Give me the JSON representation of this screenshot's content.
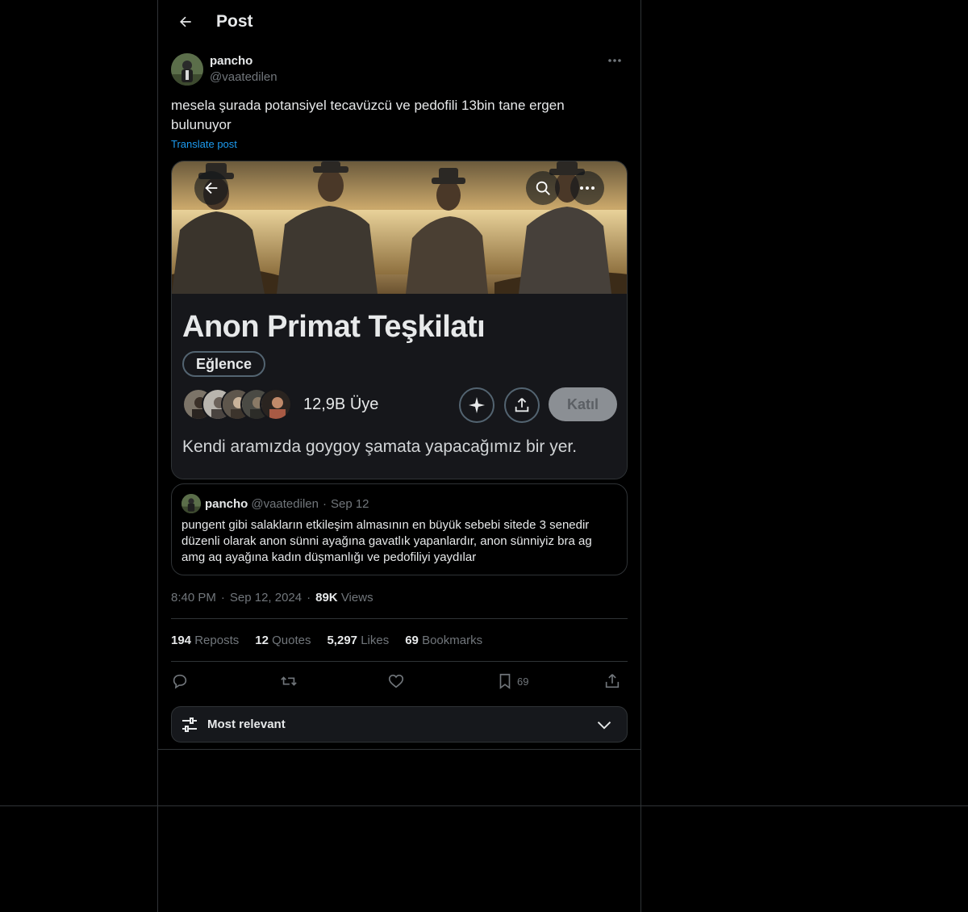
{
  "header": {
    "title": "Post"
  },
  "post": {
    "display_name": "pancho",
    "handle": "@vaatedilen",
    "text": "mesela şurada potansiyel tecavüzcü ve pedofili 13bin tane ergen bulunuyor",
    "translate_label": "Translate post",
    "time": "8:40 PM",
    "date": "Sep 12, 2024",
    "views_count": "89K",
    "views_label": "Views"
  },
  "media": {
    "community_name": "Anon Primat Teşkilatı",
    "category": "Eğlence",
    "member_count": "12,9B Üye",
    "join_label": "Katıl",
    "description": "Kendi aramızda goygoy şamata yapacağımız bir yer."
  },
  "quote": {
    "display_name": "pancho",
    "handle": "@vaatedilen",
    "separator": "·",
    "date": "Sep 12",
    "text": "pungent gibi salakların etkileşim almasının en büyük sebebi sitede 3 senedir düzenli olarak anon sünni ayağına gavatlık yapanlardır, anon sünniyiz bra ag amg aq ayağına kadın düşmanlığı ve pedofiliyi yaydılar"
  },
  "stats": {
    "reposts_count": "194",
    "reposts_label": "Reposts",
    "quotes_count": "12",
    "quotes_label": "Quotes",
    "likes_count": "5,297",
    "likes_label": "Likes",
    "bookmarks_count": "69",
    "bookmarks_label": "Bookmarks"
  },
  "actions": {
    "reply_icon": "reply-icon",
    "repost_icon": "repost-icon",
    "like_icon": "heart-icon",
    "bookmark_icon": "bookmark-icon",
    "bookmark_count": "69",
    "share_icon": "share-icon"
  },
  "sort": {
    "label": "Most relevant"
  },
  "colors": {
    "accent": "#1d9bf0",
    "text": "#e7e9ea",
    "muted": "#71767b",
    "border": "#2f3336",
    "background": "#000000"
  }
}
